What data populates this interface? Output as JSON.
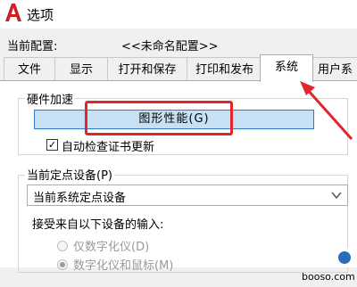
{
  "window": {
    "title": "选项",
    "app_icon": "autocad-a-icon"
  },
  "profile": {
    "label": "当前配置:",
    "value": "<<未命名配置>>"
  },
  "tabs": [
    {
      "label": "文件",
      "active": false
    },
    {
      "label": "显示",
      "active": false
    },
    {
      "label": "打开和保存",
      "active": false
    },
    {
      "label": "打印和发布",
      "active": false
    },
    {
      "label": "系统",
      "active": true
    },
    {
      "label": "用户系",
      "active": false
    }
  ],
  "hardware_acceleration": {
    "group_label": "硬件加速",
    "button_label": "图形性能(G)",
    "checkbox_label": "自动检查证书更新",
    "checkbox_checked": true
  },
  "pointing_device": {
    "group_label": "当前定点设备(P)",
    "selected": "当前系统定点设备",
    "input_label": "接受来自以下设备的输入:",
    "options": [
      {
        "label": "仅数字化仪(D)",
        "selected": false,
        "enabled": false
      },
      {
        "label": "数字化仪和鼠标(M)",
        "selected": true,
        "enabled": false
      }
    ]
  },
  "watermark": {
    "text": "booso.com"
  },
  "colors": {
    "highlight": "#e0252b",
    "button_face": "#c7e0f4",
    "button_border": "#2f78c4",
    "app_icon": "#cc1f1f"
  }
}
